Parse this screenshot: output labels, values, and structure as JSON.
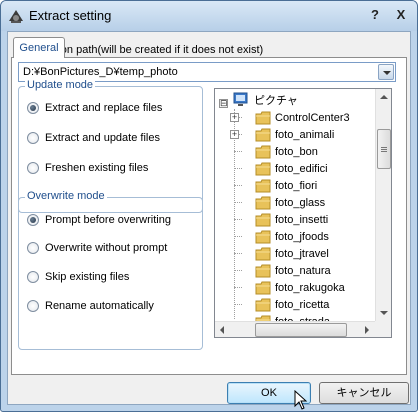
{
  "window": {
    "title": "Extract setting",
    "help_label": "?",
    "close_label": "X"
  },
  "tabs": [
    {
      "label": "General"
    }
  ],
  "destination": {
    "label": "Destination path(will be created if it does not exist)",
    "value": "D:¥BonPictures_D¥temp_photo"
  },
  "update_mode": {
    "title": "Update mode",
    "options": [
      {
        "label": "Extract and replace files",
        "checked": true
      },
      {
        "label": "Extract and update files",
        "checked": false
      },
      {
        "label": "Freshen existing files",
        "checked": false
      }
    ]
  },
  "overwrite_mode": {
    "title": "Overwrite mode",
    "options": [
      {
        "label": "Prompt before overwriting",
        "checked": true
      },
      {
        "label": "Overwrite without prompt",
        "checked": false
      },
      {
        "label": "Skip existing files",
        "checked": false
      },
      {
        "label": "Rename automatically",
        "checked": false
      }
    ]
  },
  "tree": {
    "root": {
      "label": "ピクチャ",
      "expander": "⊟"
    },
    "items": [
      {
        "label": "ControlCenter3",
        "expander": "+"
      },
      {
        "label": "foto_animali",
        "expander": "+"
      },
      {
        "label": "foto_bon"
      },
      {
        "label": "foto_edifici"
      },
      {
        "label": "foto_fiori"
      },
      {
        "label": "foto_glass"
      },
      {
        "label": "foto_insetti"
      },
      {
        "label": "foto_jfoods"
      },
      {
        "label": "foto_jtravel"
      },
      {
        "label": "foto_natura"
      },
      {
        "label": "foto_rakugoka"
      },
      {
        "label": "foto_ricetta"
      },
      {
        "label": "foto_strada"
      }
    ]
  },
  "buttons": {
    "ok": "OK",
    "cancel": "キャンセル"
  },
  "colors": {
    "accent": "#1f4e8c",
    "window_frame": "#bcd3ea",
    "folder": "#e8c25a"
  }
}
